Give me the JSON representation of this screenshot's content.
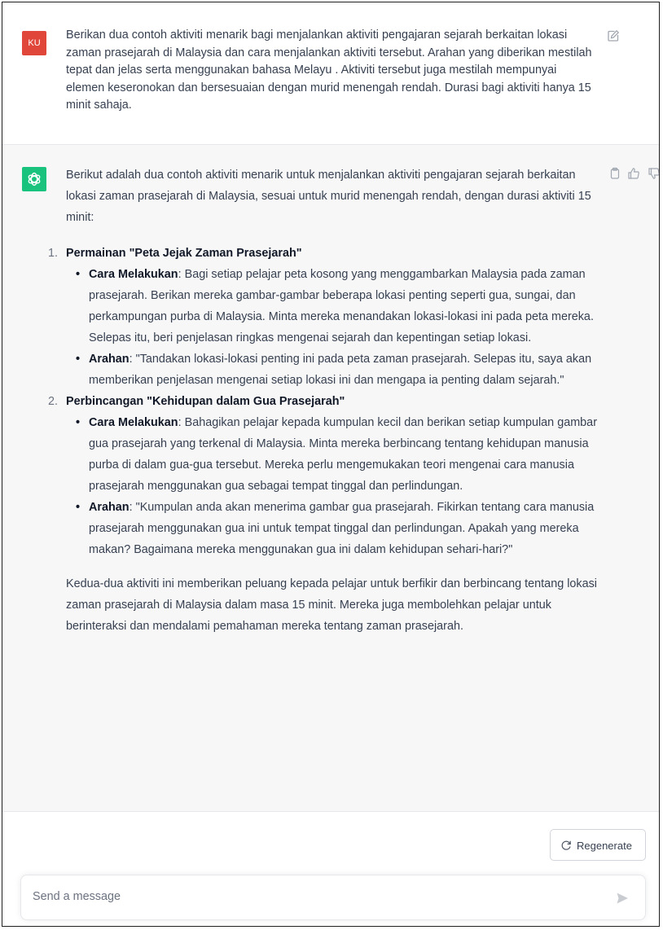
{
  "user_message": {
    "avatar_initials": "KU",
    "avatar_color": "#e0463a",
    "text": "Berikan dua contoh aktiviti menarik bagi menjalankan aktiviti pengajaran sejarah berkaitan lokasi zaman prasejarah di Malaysia dan cara menjalankan aktiviti tersebut. Arahan yang diberikan mestilah tepat dan jelas serta menggunakan bahasa  Melayu . Aktiviti tersebut juga mestilah mempunyai elemen keseronokan dan bersesuaian dengan murid menengah rendah. Durasi bagi aktiviti hanya 15  minit sahaja.",
    "edit_icon": "edit-icon"
  },
  "assistant_message": {
    "avatar_color": "#19c37d",
    "avatar_icon": "openai-logo-icon",
    "action_icons": [
      "copy-icon",
      "thumbs-up-icon",
      "thumbs-down-icon"
    ],
    "intro": "Berikut adalah dua contoh aktiviti menarik untuk menjalankan aktiviti pengajaran sejarah berkaitan lokasi zaman prasejarah di Malaysia, sesuai untuk murid menengah rendah, dengan durasi aktiviti 15 minit:",
    "items": [
      {
        "number": "1.",
        "title": "Permainan \"Peta Jejak Zaman Prasejarah\"",
        "bullets": [
          {
            "label": "Cara Melakukan",
            "text": ": Bagi setiap pelajar peta kosong yang menggambarkan Malaysia pada zaman prasejarah. Berikan mereka gambar-gambar beberapa lokasi penting seperti gua, sungai, dan perkampungan purba di Malaysia. Minta mereka menandakan lokasi-lokasi ini pada peta mereka. Selepas itu, beri penjelasan ringkas mengenai sejarah dan kepentingan setiap lokasi."
          },
          {
            "label": "Arahan",
            "text": ": \"Tandakan lokasi-lokasi penting ini pada peta zaman prasejarah. Selepas itu, saya akan memberikan penjelasan mengenai setiap lokasi ini dan mengapa ia penting dalam sejarah.\""
          }
        ]
      },
      {
        "number": "2.",
        "title": "Perbincangan \"Kehidupan dalam Gua Prasejarah\"",
        "bullets": [
          {
            "label": "Cara Melakukan",
            "text": ": Bahagikan pelajar kepada kumpulan kecil dan berikan setiap kumpulan gambar gua prasejarah yang terkenal di Malaysia. Minta mereka berbincang tentang kehidupan manusia purba di dalam gua-gua tersebut. Mereka perlu mengemukakan teori mengenai cara manusia prasejarah menggunakan gua sebagai tempat tinggal dan perlindungan."
          },
          {
            "label": "Arahan",
            "text": ": \"Kumpulan anda akan menerima gambar gua prasejarah. Fikirkan tentang cara manusia prasejarah menggunakan gua ini untuk tempat tinggal dan perlindungan. Apakah yang mereka makan? Bagaimana mereka menggunakan gua ini dalam kehidupan sehari-hari?\""
          }
        ]
      }
    ],
    "conclusion": "Kedua-dua aktiviti ini memberikan peluang kepada pelajar untuk berfikir dan berbincang tentang lokasi zaman prasejarah di Malaysia dalam masa 15 minit. Mereka juga membolehkan pelajar untuk berinteraksi dan mendalami pemahaman mereka tentang zaman prasejarah."
  },
  "regenerate": {
    "label": "Regenerate",
    "icon": "refresh-icon"
  },
  "composer": {
    "placeholder": "Send a message",
    "value": "",
    "send_icon": "send-icon"
  }
}
